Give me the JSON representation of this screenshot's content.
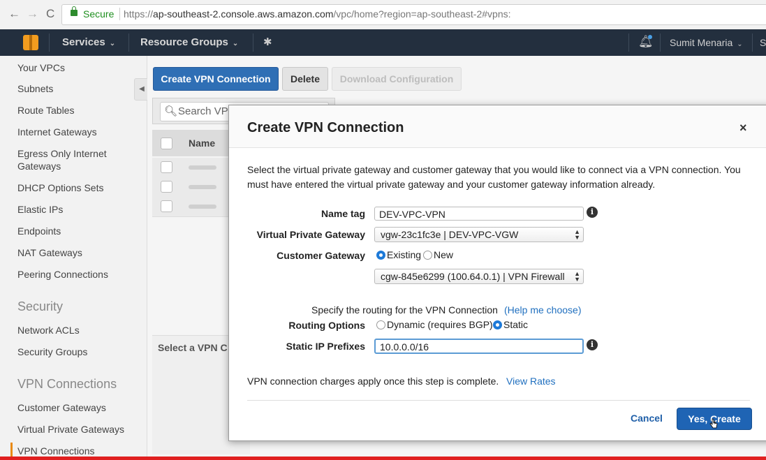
{
  "browser": {
    "back": "←",
    "forward": "→",
    "reload": "C",
    "secure_label": "Secure",
    "url_scheme": "https://",
    "url_host": "ap-southeast-2.console.aws.amazon.com",
    "url_path": "/vpc/home?region=ap-southeast-2#vpns:"
  },
  "topnav": {
    "services": "Services",
    "resource_groups": "Resource Groups",
    "user": "Sumit Menaria",
    "region_trunc": "S"
  },
  "sidebar": {
    "items": [
      "Your VPCs",
      "Subnets",
      "Route Tables",
      "Internet Gateways",
      "Egress Only Internet Gateways",
      "DHCP Options Sets",
      "Elastic IPs",
      "Endpoints",
      "NAT Gateways",
      "Peering Connections"
    ],
    "security_header": "Security",
    "security_items": [
      "Network ACLs",
      "Security Groups"
    ],
    "vpn_header": "VPN Connections",
    "vpn_items": [
      "Customer Gateways",
      "Virtual Private Gateways",
      "VPN Connections"
    ]
  },
  "toolbar": {
    "create": "Create VPN Connection",
    "delete": "Delete",
    "download": "Download Configuration"
  },
  "table": {
    "search_placeholder": "Search VP",
    "col_name": "Name",
    "select_hint": "Select a VPN C"
  },
  "modal": {
    "title": "Create VPN Connection",
    "close": "×",
    "description": "Select the virtual private gateway and customer gateway that you would like to connect via a VPN connection. You must have entered the virtual private gateway and your customer gateway information already.",
    "name_tag_label": "Name tag",
    "name_tag_value": "DEV-VPC-VPN",
    "vpg_label": "Virtual Private Gateway",
    "vpg_value": "vgw-23c1fc3e | DEV-VPC-VGW",
    "cgw_label": "Customer Gateway",
    "cgw_existing": "Existing",
    "cgw_new": "New",
    "cgw_value": "cgw-845e6299 (100.64.0.1) | VPN Firewall",
    "routing_hint": "Specify the routing for the VPN Connection",
    "routing_help": "(Help me choose)",
    "routing_label": "Routing Options",
    "routing_dynamic": "Dynamic (requires BGP)",
    "routing_static": "Static",
    "static_ip_label": "Static IP Prefixes",
    "static_ip_value": "10.0.0.0/16",
    "charges_text": "VPN connection charges apply once this step is complete.",
    "view_rates": "View Rates",
    "cancel": "Cancel",
    "yes_create": "Yes, Create"
  },
  "colors": {
    "aws_nav": "#232f3e",
    "primary_button": "#2f6fb5",
    "link": "#1f6fbf",
    "active_accent": "#e98a15"
  },
  "icons": [
    "back-icon",
    "forward-icon",
    "reload-icon",
    "lock-icon",
    "aws-logo",
    "pin-icon",
    "bell-icon",
    "search-icon",
    "close-icon",
    "info-icon",
    "cursor-icon"
  ]
}
